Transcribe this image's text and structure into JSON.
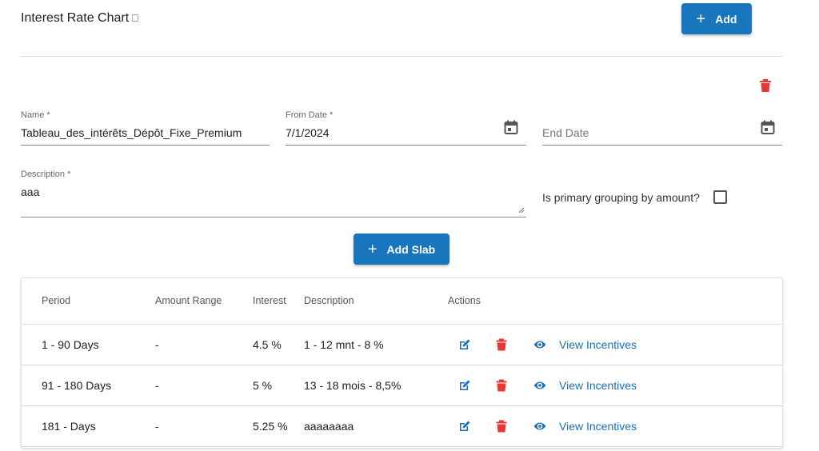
{
  "header": {
    "title": "Interest Rate Chart",
    "title_glyph": "⎕",
    "add_button": {
      "icon": "plus-icon",
      "label": "Add"
    }
  },
  "form": {
    "name": {
      "label": "Name *",
      "value": "Tableau_des_intérêts_Dépôt_Fixe_Premium"
    },
    "from_date": {
      "label": "From Date *",
      "value": "7/1/2024",
      "icon": "calendar-icon"
    },
    "end_date": {
      "placeholder": "End Date",
      "value": "",
      "icon": "calendar-icon"
    },
    "description": {
      "label": "Description *",
      "value": "aaa"
    },
    "primary_grouping": {
      "label": "Is primary grouping by amount?",
      "checked": false
    },
    "add_slab_button": {
      "icon": "plus-icon",
      "label": "Add Slab"
    }
  },
  "table": {
    "columns": [
      "Period",
      "Amount Range",
      "Interest",
      "Description",
      "Actions"
    ],
    "rows": [
      {
        "period": "1 - 90 Days",
        "amount_range": "-",
        "interest": "4.5 %",
        "description": "1 - 12 mnt - 8 %",
        "link": "View Incentives"
      },
      {
        "period": "91 - 180 Days",
        "amount_range": "-",
        "interest": "5 %",
        "description": "13 - 18 mois - 8,5%",
        "link": "View Incentives"
      },
      {
        "period": "181 - Days",
        "amount_range": "-",
        "interest": "5.25 %",
        "description": "aaaaaaaa",
        "link": "View Incentives"
      }
    ]
  },
  "colors": {
    "primary": "#1976bd",
    "danger": "#e53935",
    "link": "#1a6fb8"
  }
}
